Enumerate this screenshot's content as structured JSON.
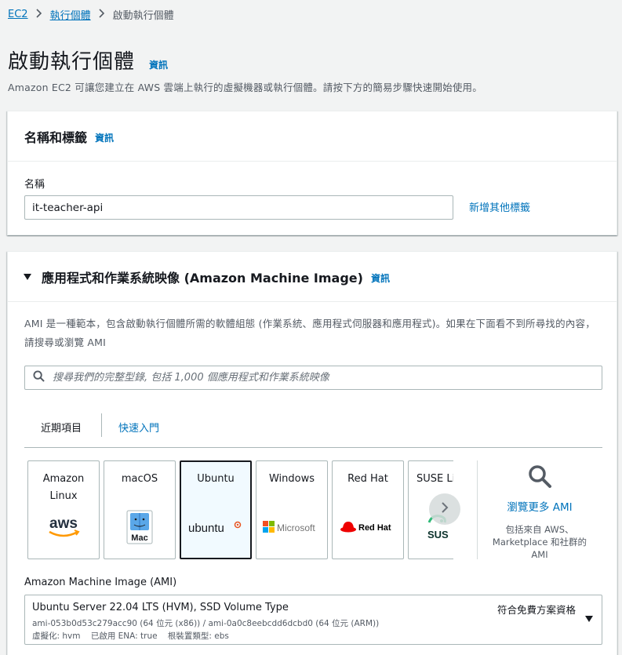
{
  "breadcrumb": {
    "root": "EC2",
    "parent": "執行個體",
    "current": "啟動執行個體"
  },
  "page": {
    "title": "啟動執行個體",
    "info": "資訊",
    "description": "Amazon EC2 可讓您建立在 AWS 雲端上執行的虛擬機器或執行個體。請按下方的簡易步驟快速開始使用。"
  },
  "name_tags": {
    "heading": "名稱和標籤",
    "info": "資訊",
    "name_label": "名稱",
    "name_value": "it-teacher-api",
    "add_tags": "新增其他標籤"
  },
  "ami_section": {
    "heading": "應用程式和作業系統映像 (Amazon Machine Image)",
    "info": "資訊",
    "description": "AMI 是一種範本，包含啟動執行個體所需的軟體組態 (作業系統、應用程式伺服器和應用程式)。如果在下面看不到所尋找的內容，請搜尋或瀏覽 AMI",
    "search_placeholder": "搜尋我們的完整型錄, 包括 1,000 個應用程式和作業系統映像",
    "tabs": [
      "近期項目",
      "快速入門"
    ],
    "tiles": [
      {
        "name": "Amazon Linux",
        "logo": "aws"
      },
      {
        "name": "macOS",
        "logo": "Mac"
      },
      {
        "name": "Ubuntu",
        "logo": "ubuntu"
      },
      {
        "name": "Windows",
        "logo": "Microsoft"
      },
      {
        "name": "Red Hat",
        "logo": "Red Hat"
      },
      {
        "name": "SUSE Li",
        "logo": "SUS"
      }
    ],
    "browse_more": "瀏覽更多 AMI",
    "browse_sub": "包括來自 AWS、Marketplace 和社群的 AMI",
    "ami_label": "Amazon Machine Image (AMI)",
    "selected_ami": {
      "name": "Ubuntu Server 22.04 LTS (HVM), SSD Volume Type",
      "free_tier": "符合免費方案資格",
      "ids": "ami-053b0d53c279acc90 (64 位元 (x86)) / ami-0a0c8eebcdd6dcbd0 (64 位元 (ARM))",
      "meta": "虛擬化: hvm    已啟用 ENA: true    根裝置類型: ebs"
    }
  },
  "colors": {
    "link": "#0073bb",
    "text": "#16191f",
    "muted": "#545b64",
    "border": "#aab7b8",
    "aws_orange": "#ff9900",
    "ubuntu_orange": "#e95420",
    "redhat_red": "#ee0000",
    "suse_green": "#30ba78"
  }
}
